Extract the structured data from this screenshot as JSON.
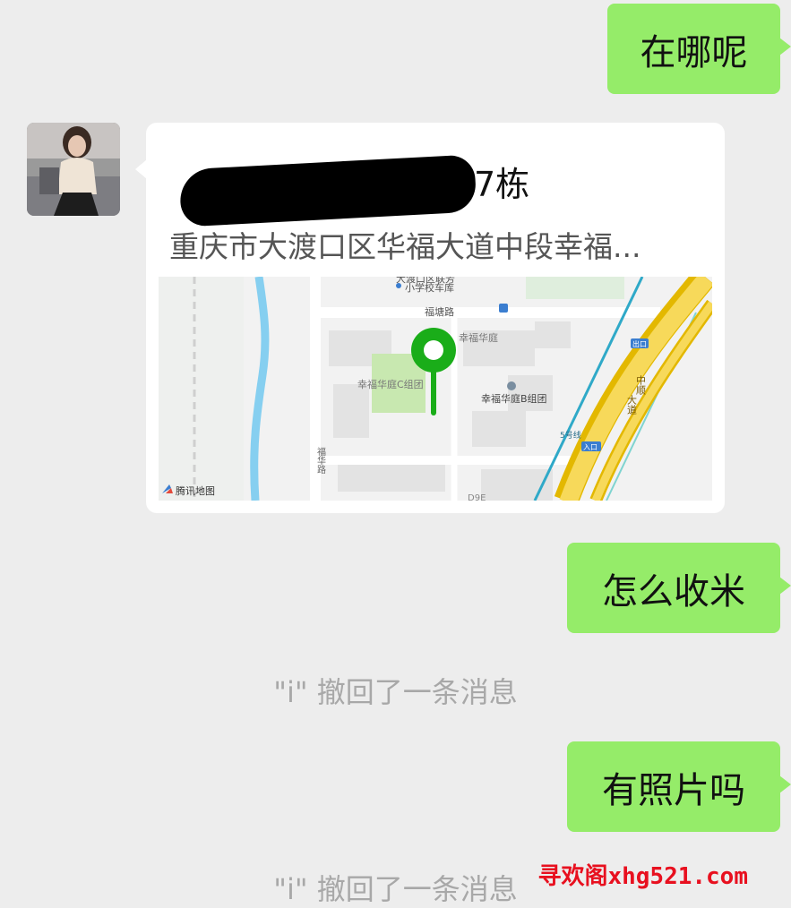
{
  "messages": {
    "m1": "在哪呢",
    "m2": "怎么收米",
    "m3": "有照片吗"
  },
  "location": {
    "title": "…7栋",
    "address": "重庆市大渡口区华福大道中段幸福...",
    "map": {
      "road_futang": "福塘路",
      "road_huahua": "福华路",
      "poi_school_1": "大渡口区联芳",
      "poi_school_2": "小学校车库",
      "poi_xingfu": "幸福华庭",
      "poi_xingfu_c": "幸福华庭C组团",
      "poi_xingfu_b": "幸福华庭B组团",
      "hw_zhongshun_1": "中顺",
      "hw_zhongshun_2": "大道",
      "exit_label": "出口",
      "entry_label": "入口",
      "line5": "5号线",
      "p0_label": "D9E",
      "brand": "腾讯地图"
    }
  },
  "system": {
    "recall1": "\"i\" 撤回了一条消息",
    "recall2": "\"i\" 撤回了一条消息"
  },
  "watermark": "寻欢阁xhg521.com",
  "colors": {
    "bubble_green": "#95ec69",
    "background": "#ededed",
    "pin_green": "#1aad19"
  }
}
